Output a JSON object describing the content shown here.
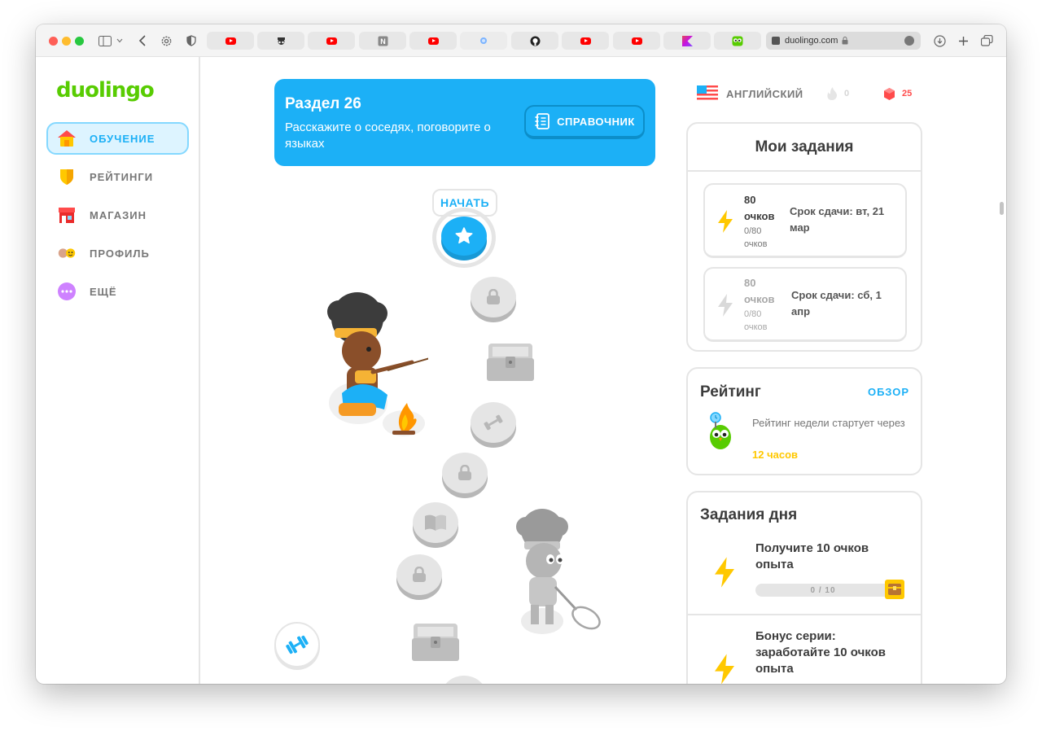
{
  "browser": {
    "url": "duolingo.com",
    "tabs": [
      "youtube",
      "spy",
      "youtube",
      "notion",
      "youtube",
      "blue",
      "github",
      "youtube",
      "youtube",
      "kotlin",
      "duolingo"
    ]
  },
  "sidebar": {
    "logo": "duolingo",
    "items": [
      {
        "label": "ОБУЧЕНИЕ",
        "icon": "home-icon",
        "active": true
      },
      {
        "label": "РЕЙТИНГИ",
        "icon": "shield-icon",
        "active": false
      },
      {
        "label": "МАГАЗИН",
        "icon": "shop-icon",
        "active": false
      },
      {
        "label": "ПРОФИЛЬ",
        "icon": "profile-icon",
        "active": false
      },
      {
        "label": "ЕЩЁ",
        "icon": "more-icon",
        "active": false
      }
    ]
  },
  "main": {
    "unit_title": "Раздел 26",
    "unit_subtitle": "Расскажите о соседях, поговорите о языках",
    "guide_label": "СПРАВОЧНИК",
    "start_label": "НАЧАТЬ"
  },
  "stats": {
    "language": "АНГЛИЙСКИЙ",
    "streak": "0",
    "gems": "25"
  },
  "quests": {
    "title": "Мои задания",
    "items": [
      {
        "points": "80",
        "unit": "очков",
        "progress": "0/80",
        "progress_unit": "очков",
        "due": "Срок сдачи: вт, 21 мар",
        "active": true
      },
      {
        "points": "80",
        "unit": "очков",
        "progress": "0/80",
        "progress_unit": "очков",
        "due": "Срок сдачи: сб, 1 апр",
        "active": false
      }
    ]
  },
  "leaderboard": {
    "title": "Рейтинг",
    "link": "ОБЗОР",
    "text": "Рейтинг недели стартует через",
    "time": "12 часов"
  },
  "daily": {
    "title": "Задания дня",
    "items": [
      {
        "text": "Получите 10 очков опыта",
        "progress_text": "0 / 10",
        "progress": 0.0
      },
      {
        "text": "Бонус серии: заработайте 10 очков опыта"
      }
    ]
  },
  "colors": {
    "brand_green": "#58cc02",
    "accent_blue": "#1cb0f6",
    "gold": "#ffc800",
    "gem_red": "#ff4b4b"
  }
}
